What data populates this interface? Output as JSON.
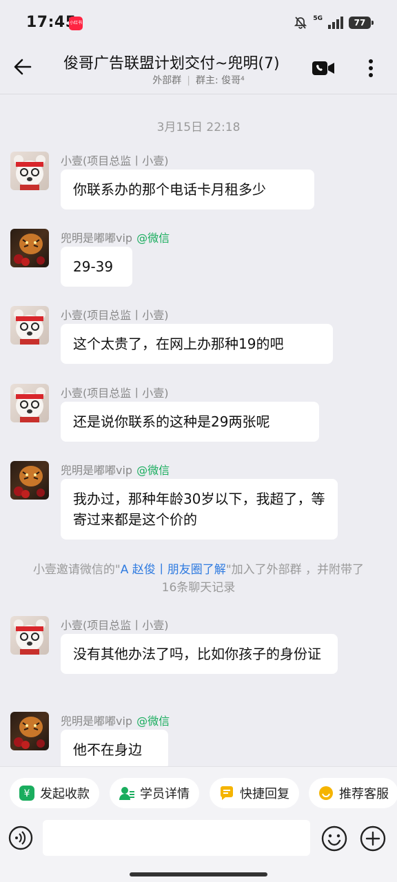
{
  "status_bar": {
    "time": "17:45",
    "app_badge": "小红书",
    "network": "5G",
    "battery": "77"
  },
  "header": {
    "title": "俊哥广告联盟计划交付~兜明(7)",
    "subtitle_group_type": "外部群",
    "subtitle_owner": "群主: 俊哥⁴"
  },
  "timestamp": "3月15日  22:18",
  "messages": [
    {
      "sender": "小壹(项目总监丨小壹)",
      "source": "",
      "text": "你联系办的那个电话卡月租多少"
    },
    {
      "sender": "兜明是嘟嘟vip",
      "source": "@微信",
      "text": "29-39"
    },
    {
      "sender": "小壹(项目总监丨小壹)",
      "source": "",
      "text": "这个太贵了，在网上办那种19的吧"
    },
    {
      "sender": "小壹(项目总监丨小壹)",
      "source": "",
      "text": "还是说你联系的这种是29两张呢"
    },
    {
      "sender": "兜明是嘟嘟vip",
      "source": "@微信",
      "text": "我办过，那种年龄30岁以下，我超了，等寄过来都是这个价的"
    },
    {
      "sender": "小壹(项目总监丨小壹)",
      "source": "",
      "text": "没有其他办法了吗，比如你孩子的身份证"
    },
    {
      "sender": "兜明是嘟嘟vip",
      "source": "@微信",
      "text": "他不在身边"
    }
  ],
  "system_notice": {
    "before": "小壹邀请微信的\"",
    "link": "A 赵俊丨朋友圈了解",
    "after": "\"加入了外部群 ，并附带了16条聊天记录"
  },
  "quick_actions": [
    {
      "label": "发起收款",
      "icon": "payment-icon",
      "color": "#1AAD5E"
    },
    {
      "label": "学员详情",
      "icon": "user-detail-icon",
      "color": "#1AAD5E"
    },
    {
      "label": "快捷回复",
      "icon": "quick-reply-icon",
      "color": "#F5B400"
    },
    {
      "label": "推荐客服",
      "icon": "customer-service-icon",
      "color": "#F5B400"
    }
  ],
  "input": {
    "placeholder": ""
  }
}
